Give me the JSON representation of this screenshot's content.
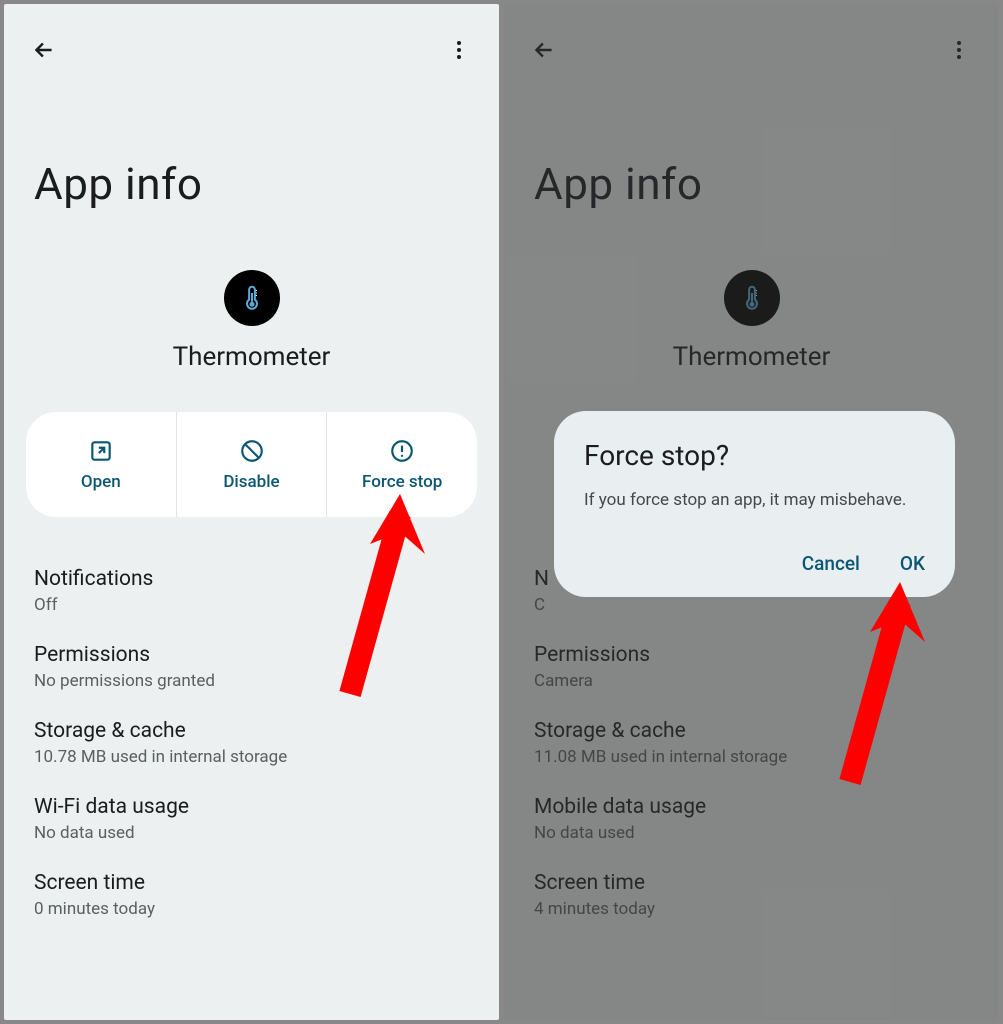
{
  "left": {
    "page_title": "App info",
    "app_name": "Thermometer",
    "actions": {
      "open": "Open",
      "disable": "Disable",
      "force_stop": "Force stop"
    },
    "settings": [
      {
        "title": "Notifications",
        "subtitle": "Off"
      },
      {
        "title": "Permissions",
        "subtitle": "No permissions granted"
      },
      {
        "title": "Storage & cache",
        "subtitle": "10.78 MB used in internal storage"
      },
      {
        "title": "Wi-Fi data usage",
        "subtitle": "No data used"
      },
      {
        "title": "Screen time",
        "subtitle": "0 minutes today"
      }
    ]
  },
  "right": {
    "page_title": "App info",
    "app_name": "Thermometer",
    "settings": [
      {
        "title": "N",
        "subtitle": "C"
      },
      {
        "title": "Permissions",
        "subtitle": "Camera"
      },
      {
        "title": "Storage & cache",
        "subtitle": "11.08 MB used in internal storage"
      },
      {
        "title": "Mobile data usage",
        "subtitle": "No data used"
      },
      {
        "title": "Screen time",
        "subtitle": "4 minutes today"
      }
    ],
    "dialog": {
      "title": "Force stop?",
      "body": "If you force stop an app, it may misbehave.",
      "cancel": "Cancel",
      "ok": "OK"
    }
  }
}
